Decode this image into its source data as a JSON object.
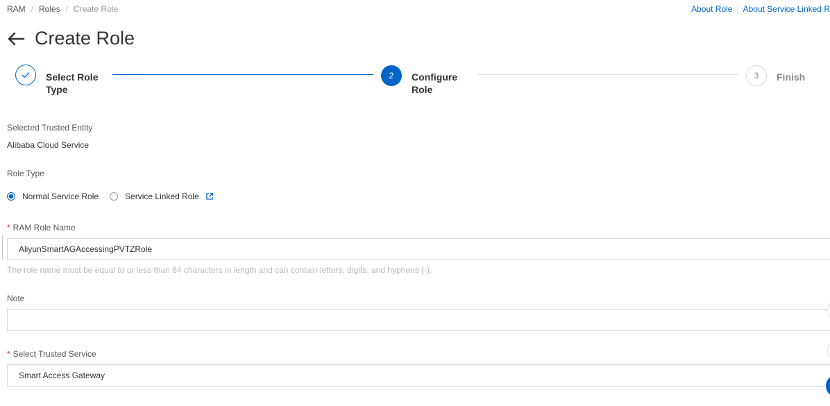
{
  "breadcrumb": {
    "items": [
      "RAM",
      "Roles",
      "Create Role"
    ]
  },
  "top_links": {
    "about_role": "About Role",
    "about_service_linked": "About Service Linked R"
  },
  "page": {
    "title": "Create Role"
  },
  "steps": [
    {
      "index": "",
      "label_line1": "Select Role",
      "label_line2": "Type",
      "status": "done"
    },
    {
      "index": "2",
      "label_line1": "Configure",
      "label_line2": "Role",
      "status": "active"
    },
    {
      "index": "3",
      "label_line1": "Finish",
      "label_line2": "",
      "status": "wait"
    }
  ],
  "trusted_entity": {
    "label": "Selected Trusted Entity",
    "value": "Alibaba Cloud Service"
  },
  "role_type": {
    "label": "Role Type",
    "options": [
      {
        "label": "Normal Service Role",
        "selected": true
      },
      {
        "label": "Service Linked Role",
        "selected": false
      }
    ]
  },
  "role_name": {
    "required_mark": "*",
    "label": "RAM Role Name",
    "value": "AliyunSmartAGAccessingPVTZRole",
    "help": "The role name must be equal to or less than 64 characters in length and can contain letters, digits, and hyphens (-)."
  },
  "note": {
    "label": "Note",
    "value": ""
  },
  "trusted_service": {
    "required_mark": "*",
    "label": "Select Trusted Service",
    "value": "Smart Access Gateway"
  },
  "colors": {
    "accent": "#0064c8",
    "required": "#d93026",
    "border": "#d7d7d7"
  }
}
